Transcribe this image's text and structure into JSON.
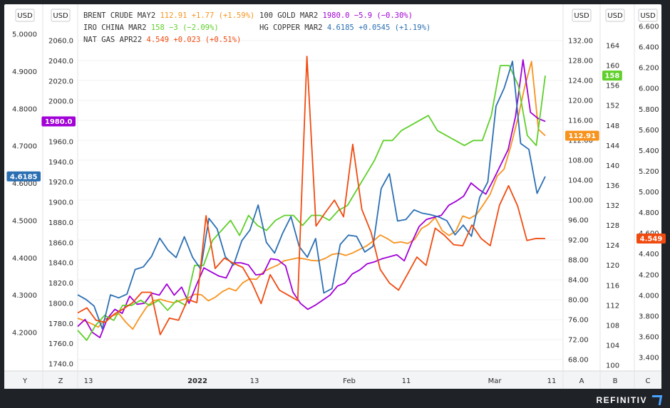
{
  "footer": {
    "brand": "REFINITIV"
  },
  "chart_data": {
    "type": "line",
    "x_ticks": [
      "13",
      "2022",
      "13",
      "Feb",
      "11",
      "Mar",
      "11"
    ],
    "axis_ids": [
      "Y",
      "Z",
      "A",
      "B",
      "C"
    ],
    "axis_unit": "USD",
    "axes": [
      {
        "id": "Y",
        "side": "left",
        "unit": "USD",
        "range": [
          4.17,
          5.03
        ],
        "ticks": [
          "4.2000",
          "4.3000",
          "4.4000",
          "4.5000",
          "4.6000",
          "4.7000",
          "4.8000",
          "4.9000",
          "5.0000"
        ],
        "tick_values": [
          4.2,
          4.3,
          4.4,
          4.5,
          4.6,
          4.7,
          4.8,
          4.9,
          5.0
        ]
      },
      {
        "id": "Z",
        "side": "left",
        "unit": "USD",
        "range": [
          1733,
          2045
        ],
        "ticks": [
          "1740.0",
          "1760.0",
          "1780.0",
          "1800.0",
          "1820.0",
          "1840.0",
          "1860.0",
          "1880.0",
          "1900.0",
          "1920.0",
          "1940.0",
          "1960.0",
          "1980.0",
          "2000.0",
          "2020.0",
          "2040.0",
          "2060.0"
        ],
        "tick_values": [
          1740,
          1760,
          1780,
          1800,
          1820,
          1840,
          1860,
          1880,
          1900,
          1920,
          1940,
          1960,
          1980,
          2000,
          2020,
          2040,
          2060
        ]
      },
      {
        "id": "A",
        "side": "right",
        "unit": "USD",
        "range": [
          65,
          133
        ],
        "ticks": [
          "68.00",
          "72.00",
          "76.00",
          "80.00",
          "84.00",
          "88.00",
          "92.00",
          "96.00",
          "100.00",
          "104.00",
          "108.00",
          "112.00",
          "116.00",
          "120.00",
          "124.00",
          "128.00",
          "132.00"
        ],
        "tick_values": [
          68,
          72,
          76,
          80,
          84,
          88,
          92,
          96,
          100,
          104,
          108,
          112,
          116,
          120,
          124,
          128,
          132
        ]
      },
      {
        "id": "B",
        "side": "right",
        "unit": "USD",
        "range": [
          99,
          167
        ],
        "ticks": [
          "100",
          "104",
          "108",
          "112",
          "116",
          "120",
          "124",
          "128",
          "132",
          "136",
          "140",
          "144",
          "148",
          "152",
          "156",
          "160",
          "164"
        ],
        "tick_values": [
          100,
          104,
          108,
          112,
          116,
          120,
          124,
          128,
          132,
          136,
          140,
          144,
          148,
          152,
          156,
          160,
          164
        ]
      },
      {
        "id": "C",
        "side": "right",
        "unit": "USD",
        "range": [
          3.28,
          6.6
        ],
        "ticks": [
          "3.400",
          "3.600",
          "3.800",
          "4.000",
          "4.200",
          "4.400",
          "4.600",
          "4.800",
          "5.000",
          "5.200",
          "5.400",
          "5.600",
          "5.800",
          "6.000",
          "6.200",
          "6.400",
          "6.600"
        ],
        "tick_values": [
          3.4,
          3.6,
          3.8,
          4.0,
          4.2,
          4.4,
          4.6,
          4.8,
          5.0,
          5.2,
          5.4,
          5.6,
          5.8,
          6.0,
          6.2,
          6.4,
          6.6
        ]
      }
    ],
    "legend": [
      [
        {
          "name": "BRENT CRUDE MAY2",
          "value": "112.91",
          "change": "+1.77 (+1.59%)",
          "color": "#f7931e"
        },
        {
          "name": "100 GOLD MAR2",
          "value": "1980.0",
          "change": "−5.9 (−0.30%)",
          "color": "#a100d6"
        }
      ],
      [
        {
          "name": "IRO CHINA MAR2",
          "value": "158",
          "change": "−3 (−2.09%)",
          "color": "#5fcf2a"
        },
        {
          "name": "HG COPPER MAR2",
          "value": "4.6185",
          "change": "+0.0545 (+1.19%)",
          "color": "#2b6fb3"
        }
      ],
      [
        {
          "name": "NAT GAS APR22",
          "value": "4.549",
          "change": "+0.023 (+0.51%)",
          "color": "#f04a0f"
        }
      ]
    ],
    "series": [
      {
        "name": "BRENT CRUDE MAY2",
        "axis": "A",
        "color": "#f7931e",
        "last_label": "112.91",
        "values": [
          76.3,
          75.8,
          75.2,
          74.5,
          76.1,
          76.8,
          77.2,
          75.5,
          74.1,
          76.4,
          78.5,
          79.8,
          80.1,
          79.7,
          79.4,
          79.9,
          80.3,
          81.1,
          81.0,
          79.8,
          80.5,
          81.6,
          82.3,
          81.8,
          83.4,
          84.2,
          84.1,
          85.6,
          86.3,
          86.9,
          87.8,
          88.1,
          88.4,
          88.2,
          87.9,
          87.8,
          88.3,
          89.1,
          89.3,
          88.9,
          89.4,
          90.1,
          90.8,
          91.8,
          93.0,
          92.3,
          91.4,
          91.6,
          91.3,
          92.1,
          94.3,
          95.1,
          96.5,
          93.9,
          92.9,
          93.8,
          96.8,
          96.3,
          97.1,
          99.1,
          101.2,
          104.8,
          106.2,
          110.9,
          116.3,
          122.7,
          127.8,
          114.2,
          112.91
        ]
      },
      {
        "name": "100 GOLD MAR2",
        "axis": "Z",
        "color": "#a100d6",
        "last_label": "1980.0",
        "values": [
          1777,
          1784,
          1771,
          1766,
          1785,
          1794,
          1790,
          1807,
          1799,
          1800,
          1810,
          1808,
          1819,
          1808,
          1816,
          1800,
          1818,
          1835,
          1831,
          1827,
          1825,
          1840,
          1840,
          1838,
          1828,
          1829,
          1844,
          1843,
          1837,
          1811,
          1800,
          1794,
          1798,
          1803,
          1808,
          1817,
          1820,
          1829,
          1833,
          1839,
          1841,
          1844,
          1846,
          1848,
          1842,
          1860,
          1876,
          1883,
          1885,
          1887,
          1897,
          1901,
          1906,
          1919,
          1913,
          1908,
          1922,
          1937,
          1952,
          1985,
          2041,
          1989,
          1983,
          1980.0
        ]
      },
      {
        "name": "IRO CHINA MAR2",
        "axis": "B",
        "color": "#5fcf2a",
        "last_label": "158",
        "values": [
          107,
          105,
          108,
          110,
          109,
          112,
          112,
          113,
          112,
          113,
          111,
          113,
          112,
          120,
          120,
          125,
          127,
          129,
          126,
          130,
          128,
          127,
          129,
          130,
          130,
          128,
          130,
          130,
          129,
          131,
          132,
          135,
          138,
          141,
          145,
          145,
          147,
          148,
          149,
          150,
          147,
          146,
          145,
          144,
          145,
          145,
          150,
          160,
          160,
          156,
          146,
          144,
          158
        ]
      },
      {
        "name": "HG COPPER MAR2",
        "axis": "Y",
        "color": "#2b6fb3",
        "last_label": "4.6185",
        "values": [
          4.301,
          4.289,
          4.271,
          4.21,
          4.301,
          4.293,
          4.303,
          4.369,
          4.376,
          4.404,
          4.453,
          4.421,
          4.401,
          4.457,
          4.402,
          4.37,
          4.506,
          4.478,
          4.403,
          4.381,
          4.446,
          4.475,
          4.542,
          4.442,
          4.413,
          4.467,
          4.511,
          4.431,
          4.402,
          4.452,
          4.306,
          4.318,
          4.436,
          4.461,
          4.458,
          4.416,
          4.431,
          4.586,
          4.626,
          4.499,
          4.503,
          4.529,
          4.52,
          4.516,
          4.51,
          4.5,
          4.462,
          4.488,
          4.458,
          4.562,
          4.604,
          4.807,
          4.856,
          4.927,
          4.707,
          4.691,
          4.573,
          4.6185
        ]
      },
      {
        "name": "NAT GAS APR22",
        "axis": "C",
        "color": "#f04a0f",
        "last_label": "4.549",
        "values": [
          3.83,
          3.88,
          3.76,
          3.74,
          3.82,
          3.87,
          3.93,
          4.03,
          4.03,
          3.62,
          3.78,
          3.76,
          3.96,
          3.93,
          4.77,
          4.26,
          4.36,
          4.31,
          4.27,
          4.12,
          3.92,
          4.2,
          4.05,
          4.0,
          3.95,
          6.31,
          4.67,
          4.8,
          4.92,
          4.76,
          5.46,
          4.83,
          4.61,
          4.25,
          4.12,
          4.05,
          4.21,
          4.37,
          4.29,
          4.65,
          4.58,
          4.49,
          4.48,
          4.68,
          4.55,
          4.48,
          4.87,
          5.06,
          4.86,
          4.53,
          4.55,
          4.549
        ]
      }
    ]
  }
}
